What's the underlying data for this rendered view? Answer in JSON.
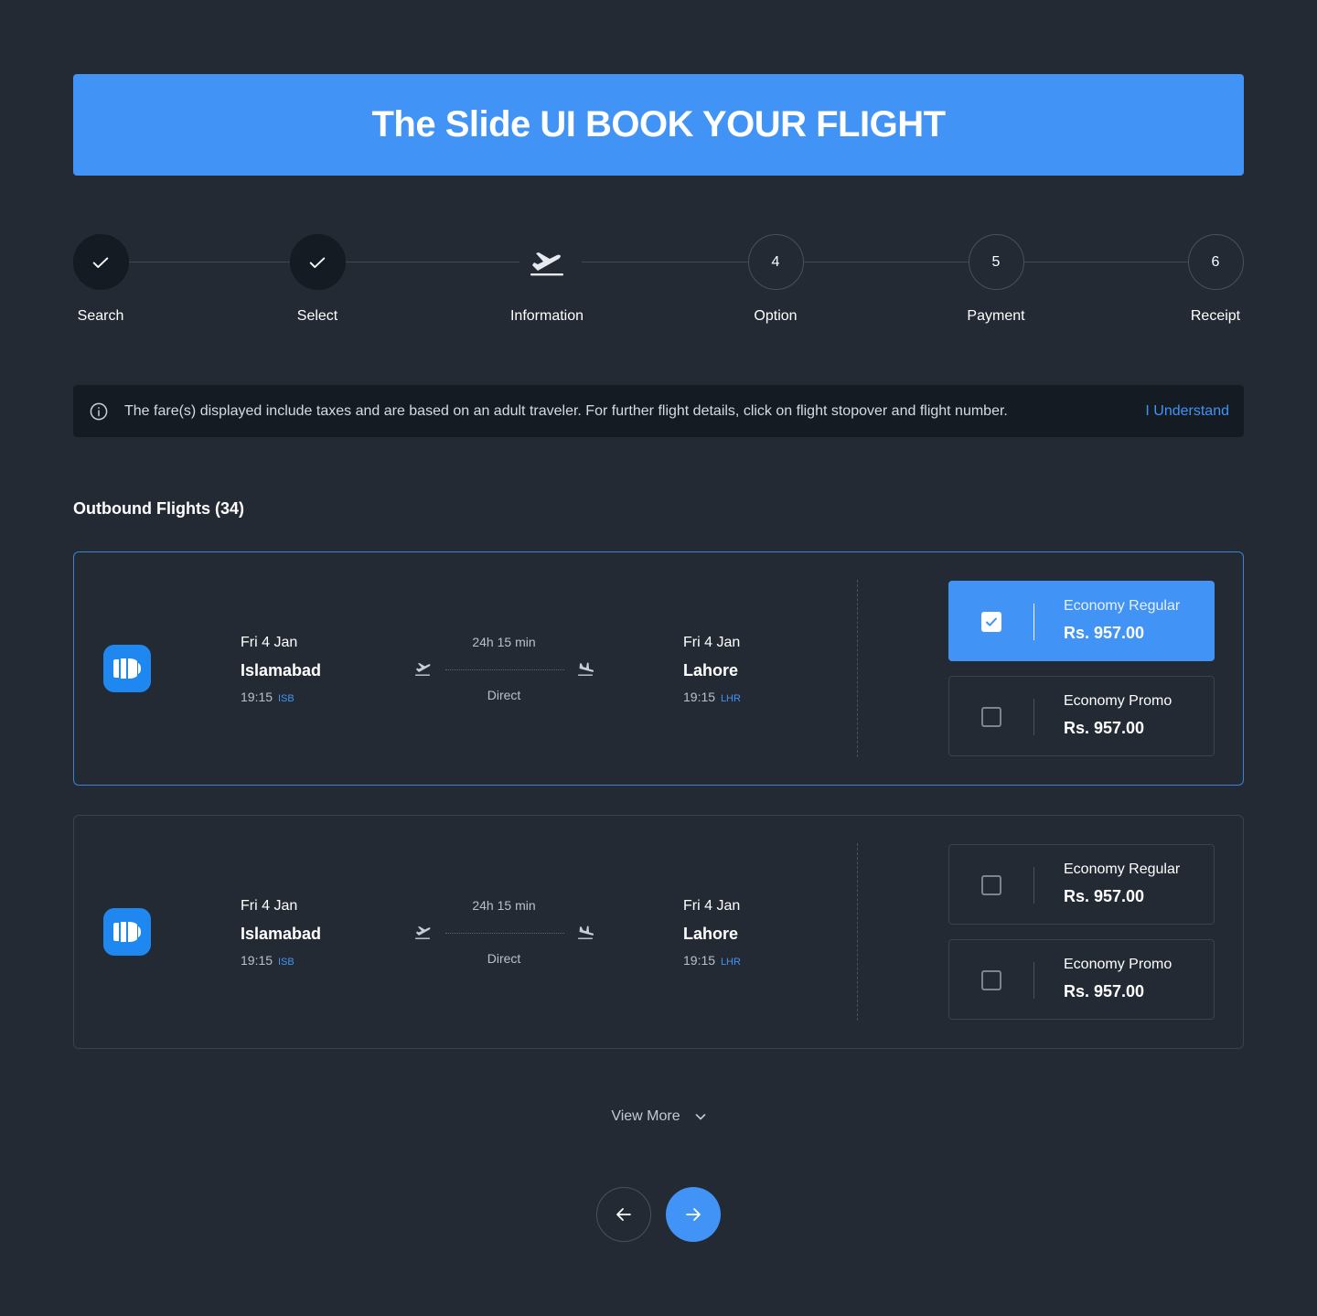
{
  "header": {
    "title": "The Slide UI BOOK YOUR FLIGHT"
  },
  "stepper": {
    "steps": [
      {
        "label": "Search",
        "state": "done",
        "marker": ""
      },
      {
        "label": "Select",
        "state": "done",
        "marker": ""
      },
      {
        "label": "Information",
        "state": "active",
        "marker": "plane-takeoff-icon"
      },
      {
        "label": "Option",
        "state": "todo",
        "marker": "4"
      },
      {
        "label": "Payment",
        "state": "todo",
        "marker": "5"
      },
      {
        "label": "Receipt",
        "state": "todo",
        "marker": "6"
      }
    ]
  },
  "alert": {
    "text": "The fare(s) displayed include taxes and are based on an adult traveler. For further flight details, click on flight stopover and flight number.",
    "action_label": "I Understand"
  },
  "outbound": {
    "title": "Outbound Flights (34)",
    "flights": [
      {
        "selected": true,
        "depart": {
          "date": "Fri 4 Jan",
          "city": "Islamabad",
          "time": "19:15",
          "code": "ISB"
        },
        "duration": "24h 15 min",
        "stops": "Direct",
        "arrive": {
          "date": "Fri 4 Jan",
          "city": "Lahore",
          "time": "19:15",
          "code": "LHR"
        },
        "fares": [
          {
            "name": "Economy Regular",
            "price": "Rs. 957.00",
            "checked": true
          },
          {
            "name": "Economy Promo",
            "price": "Rs. 957.00",
            "checked": false
          }
        ]
      },
      {
        "selected": false,
        "depart": {
          "date": "Fri 4 Jan",
          "city": "Islamabad",
          "time": "19:15",
          "code": "ISB"
        },
        "duration": "24h 15 min",
        "stops": "Direct",
        "arrive": {
          "date": "Fri 4 Jan",
          "city": "Lahore",
          "time": "19:15",
          "code": "LHR"
        },
        "fares": [
          {
            "name": "Economy Regular",
            "price": "Rs. 957.00",
            "checked": false
          },
          {
            "name": "Economy Promo",
            "price": "Rs. 957.00",
            "checked": false
          }
        ]
      }
    ],
    "view_more_label": "View More"
  },
  "colors": {
    "background": "#232a33",
    "accent": "#4193f5",
    "surface_dark": "#151b23",
    "border": "#3a424d"
  }
}
